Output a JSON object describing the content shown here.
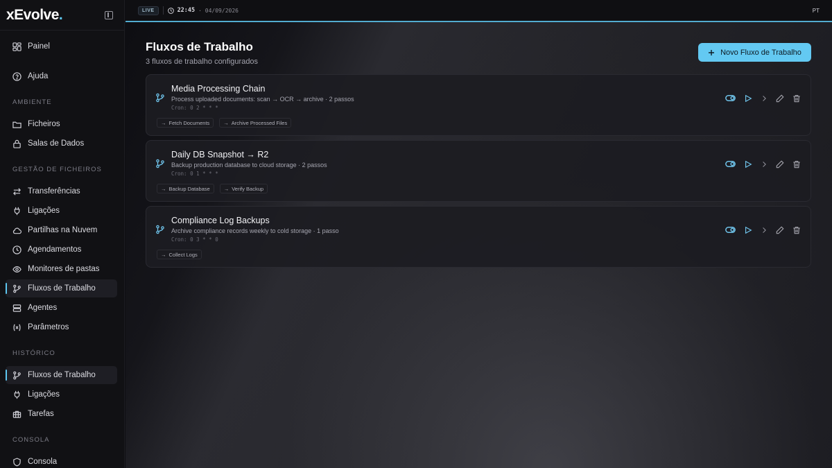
{
  "brand": {
    "name": "xEvolve",
    "dot": "."
  },
  "colors": {
    "accent": "#5ec8f2",
    "button": "#63c9f2"
  },
  "sidebar": {
    "top_items": [
      {
        "label": "Painel",
        "icon": "dashboard-icon"
      },
      {
        "label": "Ajuda",
        "icon": "help-icon"
      }
    ],
    "sections": [
      {
        "title": "AMBIENTE",
        "items": [
          {
            "label": "Ficheiros",
            "icon": "folder-icon"
          },
          {
            "label": "Salas de Dados",
            "icon": "lock-icon"
          }
        ]
      },
      {
        "title": "GESTÃO DE FICHEIROS",
        "items": [
          {
            "label": "Transferências",
            "icon": "transfer-icon"
          },
          {
            "label": "Ligações",
            "icon": "plug-icon"
          },
          {
            "label": "Partilhas na Nuvem",
            "icon": "cloud-icon"
          },
          {
            "label": "Agendamentos",
            "icon": "clock-icon"
          },
          {
            "label": "Monitores de pastas",
            "icon": "eye-icon"
          },
          {
            "label": "Fluxos de Trabalho",
            "icon": "workflow-icon",
            "active": true
          },
          {
            "label": "Agentes",
            "icon": "server-icon"
          },
          {
            "label": "Parâmetros",
            "icon": "variable-icon"
          }
        ]
      },
      {
        "title": "HISTÓRICO",
        "items": [
          {
            "label": "Fluxos de Trabalho",
            "icon": "workflow-icon",
            "active": true
          },
          {
            "label": "Ligações",
            "icon": "plug-icon"
          },
          {
            "label": "Tarefas",
            "icon": "briefcase-icon"
          }
        ]
      },
      {
        "title": "CONSOLA",
        "items": [
          {
            "label": "Consola",
            "icon": "shield-icon"
          }
        ]
      }
    ]
  },
  "topbar": {
    "live": "LIVE",
    "time": "22:45",
    "date": "· 04/09/2026",
    "lang": "PT"
  },
  "page": {
    "title": "Fluxos de Trabalho",
    "subtitle": "3 fluxos de trabalho configurados",
    "new_button": "Novo Fluxo de Trabalho"
  },
  "workflows": [
    {
      "name": "Media Processing Chain",
      "description": "Process uploaded documents: scan → OCR → archive · 2 passos",
      "cron": "Cron: 0 2 * * *",
      "steps": [
        "Fetch Documents",
        "Archive Processed Files"
      ]
    },
    {
      "name": "Daily DB Snapshot → R2",
      "description": "Backup production database to cloud storage · 2 passos",
      "cron": "Cron: 0 1 * * *",
      "steps": [
        "Backup Database",
        "Verify Backup"
      ]
    },
    {
      "name": "Compliance Log Backups",
      "description": "Archive compliance records weekly to cold storage · 1 passo",
      "cron": "Cron: 0 3 * * 0",
      "steps": [
        "Collect Logs"
      ]
    }
  ]
}
